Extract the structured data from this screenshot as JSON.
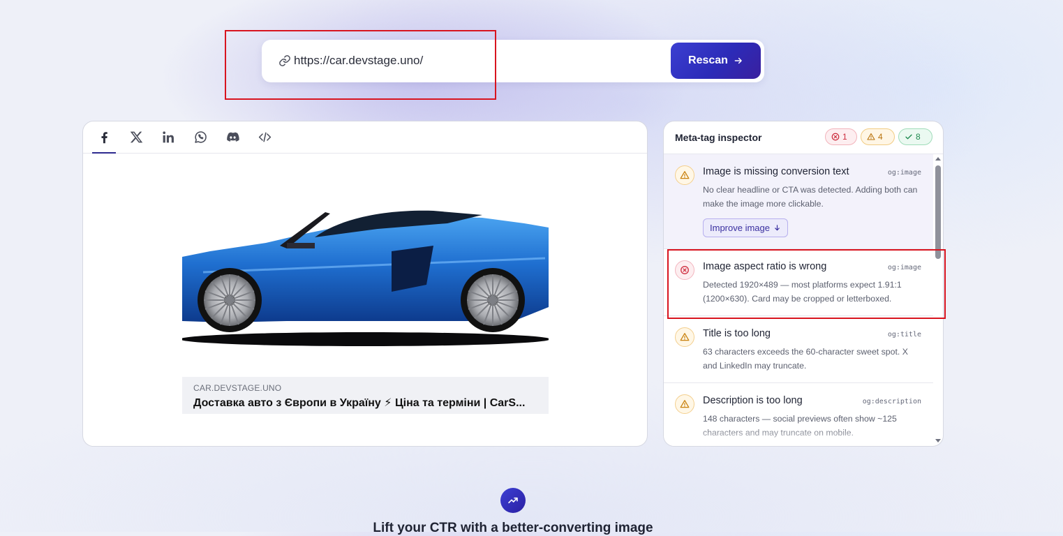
{
  "url_bar": {
    "value": "https://car.devstage.uno/",
    "rescan_label": "Rescan"
  },
  "preview": {
    "tabs": [
      {
        "name": "facebook",
        "icon": "facebook-icon",
        "active": true
      },
      {
        "name": "x",
        "icon": "x-icon",
        "active": false
      },
      {
        "name": "linkedin",
        "icon": "linkedin-icon",
        "active": false
      },
      {
        "name": "whatsapp",
        "icon": "whatsapp-icon",
        "active": false
      },
      {
        "name": "discord",
        "icon": "discord-icon",
        "active": false
      },
      {
        "name": "code",
        "icon": "code-icon",
        "active": false
      }
    ],
    "card": {
      "domain": "CAR.DEVSTAGE.UNO",
      "title": "Доставка авто з Європи в Україну ⚡ Ціна та терміни | CarS..."
    }
  },
  "inspector": {
    "title": "Meta-tag inspector",
    "counts": {
      "errors": "1",
      "warnings": "4",
      "passed": "8"
    },
    "issues": [
      {
        "severity": "warning",
        "title": "Image is missing conversion text",
        "tag": "og:image",
        "description": "No clear headline or CTA was detected. Adding both can make the image more clickable.",
        "action_label": "Improve image"
      },
      {
        "severity": "error",
        "title": "Image aspect ratio is wrong",
        "tag": "og:image",
        "description": "Detected 1920×489 — most platforms expect 1.91:1 (1200×630). Card may be cropped or letterboxed."
      },
      {
        "severity": "warning",
        "title": "Title is too long",
        "tag": "og:title",
        "description": "63 characters exceeds the 60-character sweet spot. X and LinkedIn may truncate."
      },
      {
        "severity": "warning",
        "title": "Description is too long",
        "tag": "og:description",
        "description": "148 characters — social previews often show ~125 characters and may truncate on mobile."
      }
    ]
  },
  "bottom": {
    "heading": "Lift your CTR with a better-converting image",
    "icon": "trending-up-icon"
  },
  "colors": {
    "accent": "#3b3fd1",
    "annotation": "#d8141f",
    "error": "#cc2c3d",
    "warning": "#b8710a",
    "success": "#1e8a4f"
  }
}
